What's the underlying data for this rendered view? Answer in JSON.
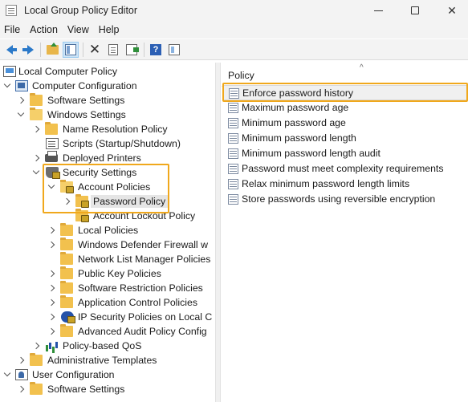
{
  "window": {
    "title": "Local Group Policy Editor"
  },
  "menu": [
    "File",
    "Action",
    "View",
    "Help"
  ],
  "toolbar": {
    "icons": [
      "back-icon",
      "forward-icon",
      "up-folder-icon",
      "show-hide-tree-icon",
      "delete-icon",
      "properties-icon",
      "export-list-icon",
      "help-icon",
      "show-pane-icon"
    ]
  },
  "tree": {
    "items": [
      {
        "label": "Local Computer Policy",
        "icon": "computer-icon",
        "state": "none"
      },
      {
        "label": "Computer Configuration",
        "icon": "computer-config-icon",
        "state": "expanded"
      },
      {
        "label": "Software Settings",
        "icon": "folder-icon",
        "state": "collapsed"
      },
      {
        "label": "Windows Settings",
        "icon": "folder-icon",
        "state": "expanded"
      },
      {
        "label": "Name Resolution Policy",
        "icon": "folder-icon",
        "state": "collapsed"
      },
      {
        "label": "Scripts (Startup/Shutdown)",
        "icon": "scripts-icon",
        "state": "none"
      },
      {
        "label": "Deployed Printers",
        "icon": "printer-icon",
        "state": "collapsed"
      },
      {
        "label": "Security Settings",
        "icon": "security-settings-icon",
        "state": "expanded"
      },
      {
        "label": "Account Policies",
        "icon": "locked-folder-icon",
        "state": "expanded"
      },
      {
        "label": "Password Policy",
        "icon": "locked-folder-icon",
        "state": "collapsed",
        "selected": true
      },
      {
        "label": "Account Lockout Policy",
        "icon": "locked-folder-icon",
        "state": "none"
      },
      {
        "label": "Local Policies",
        "icon": "folder-icon",
        "state": "collapsed"
      },
      {
        "label": "Windows Defender Firewall w",
        "icon": "folder-icon",
        "state": "collapsed"
      },
      {
        "label": "Network List Manager Policies",
        "icon": "folder-icon",
        "state": "none"
      },
      {
        "label": "Public Key Policies",
        "icon": "folder-icon",
        "state": "collapsed"
      },
      {
        "label": "Software Restriction Policies",
        "icon": "folder-icon",
        "state": "collapsed"
      },
      {
        "label": "Application Control Policies",
        "icon": "folder-icon",
        "state": "collapsed"
      },
      {
        "label": "IP Security Policies on Local C",
        "icon": "ip-security-icon",
        "state": "collapsed"
      },
      {
        "label": "Advanced Audit Policy Config",
        "icon": "folder-icon",
        "state": "collapsed"
      },
      {
        "label": "Policy-based QoS",
        "icon": "qos-chart-icon",
        "state": "collapsed"
      },
      {
        "label": "Administrative Templates",
        "icon": "folder-icon",
        "state": "collapsed"
      },
      {
        "label": "User Configuration",
        "icon": "user-config-icon",
        "state": "expanded"
      },
      {
        "label": "Software Settings",
        "icon": "folder-icon",
        "state": "collapsed"
      }
    ]
  },
  "list": {
    "column_header": "Policy",
    "items": [
      {
        "label": "Enforce password history",
        "selected": true
      },
      {
        "label": "Maximum password age"
      },
      {
        "label": "Minimum password age"
      },
      {
        "label": "Minimum password length"
      },
      {
        "label": "Minimum password length audit"
      },
      {
        "label": "Password must meet complexity requirements"
      },
      {
        "label": "Relax minimum password length limits"
      },
      {
        "label": "Store passwords using reversible encryption"
      }
    ]
  },
  "colors": {
    "highlight": "#f0a81c",
    "selection": "#e5e5e5",
    "accent": "#2b79c9"
  }
}
